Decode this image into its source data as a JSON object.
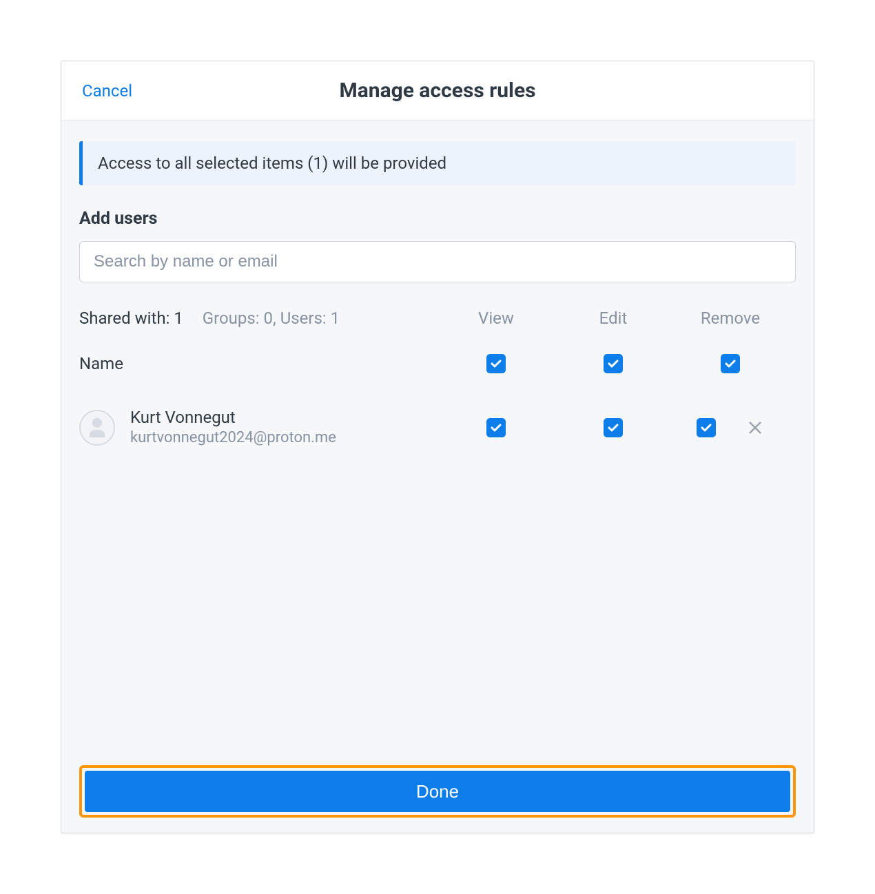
{
  "header": {
    "cancel": "Cancel",
    "title": "Manage access rules"
  },
  "banner": "Access to all selected items (1) will be provided",
  "addUsers": {
    "heading": "Add users",
    "searchPlaceholder": "Search by name or email"
  },
  "summary": {
    "sharedWith": "Shared with: 1",
    "groupsUsers": "Groups: 0, Users: 1"
  },
  "columns": {
    "name": "Name",
    "view": "View",
    "edit": "Edit",
    "remove": "Remove"
  },
  "headerChecks": {
    "view": true,
    "edit": true,
    "remove": true
  },
  "users": [
    {
      "name": "Kurt Vonnegut",
      "email": "kurtvonnegut2024@proton.me",
      "view": true,
      "edit": true,
      "remove": true
    }
  ],
  "footer": {
    "done": "Done"
  }
}
